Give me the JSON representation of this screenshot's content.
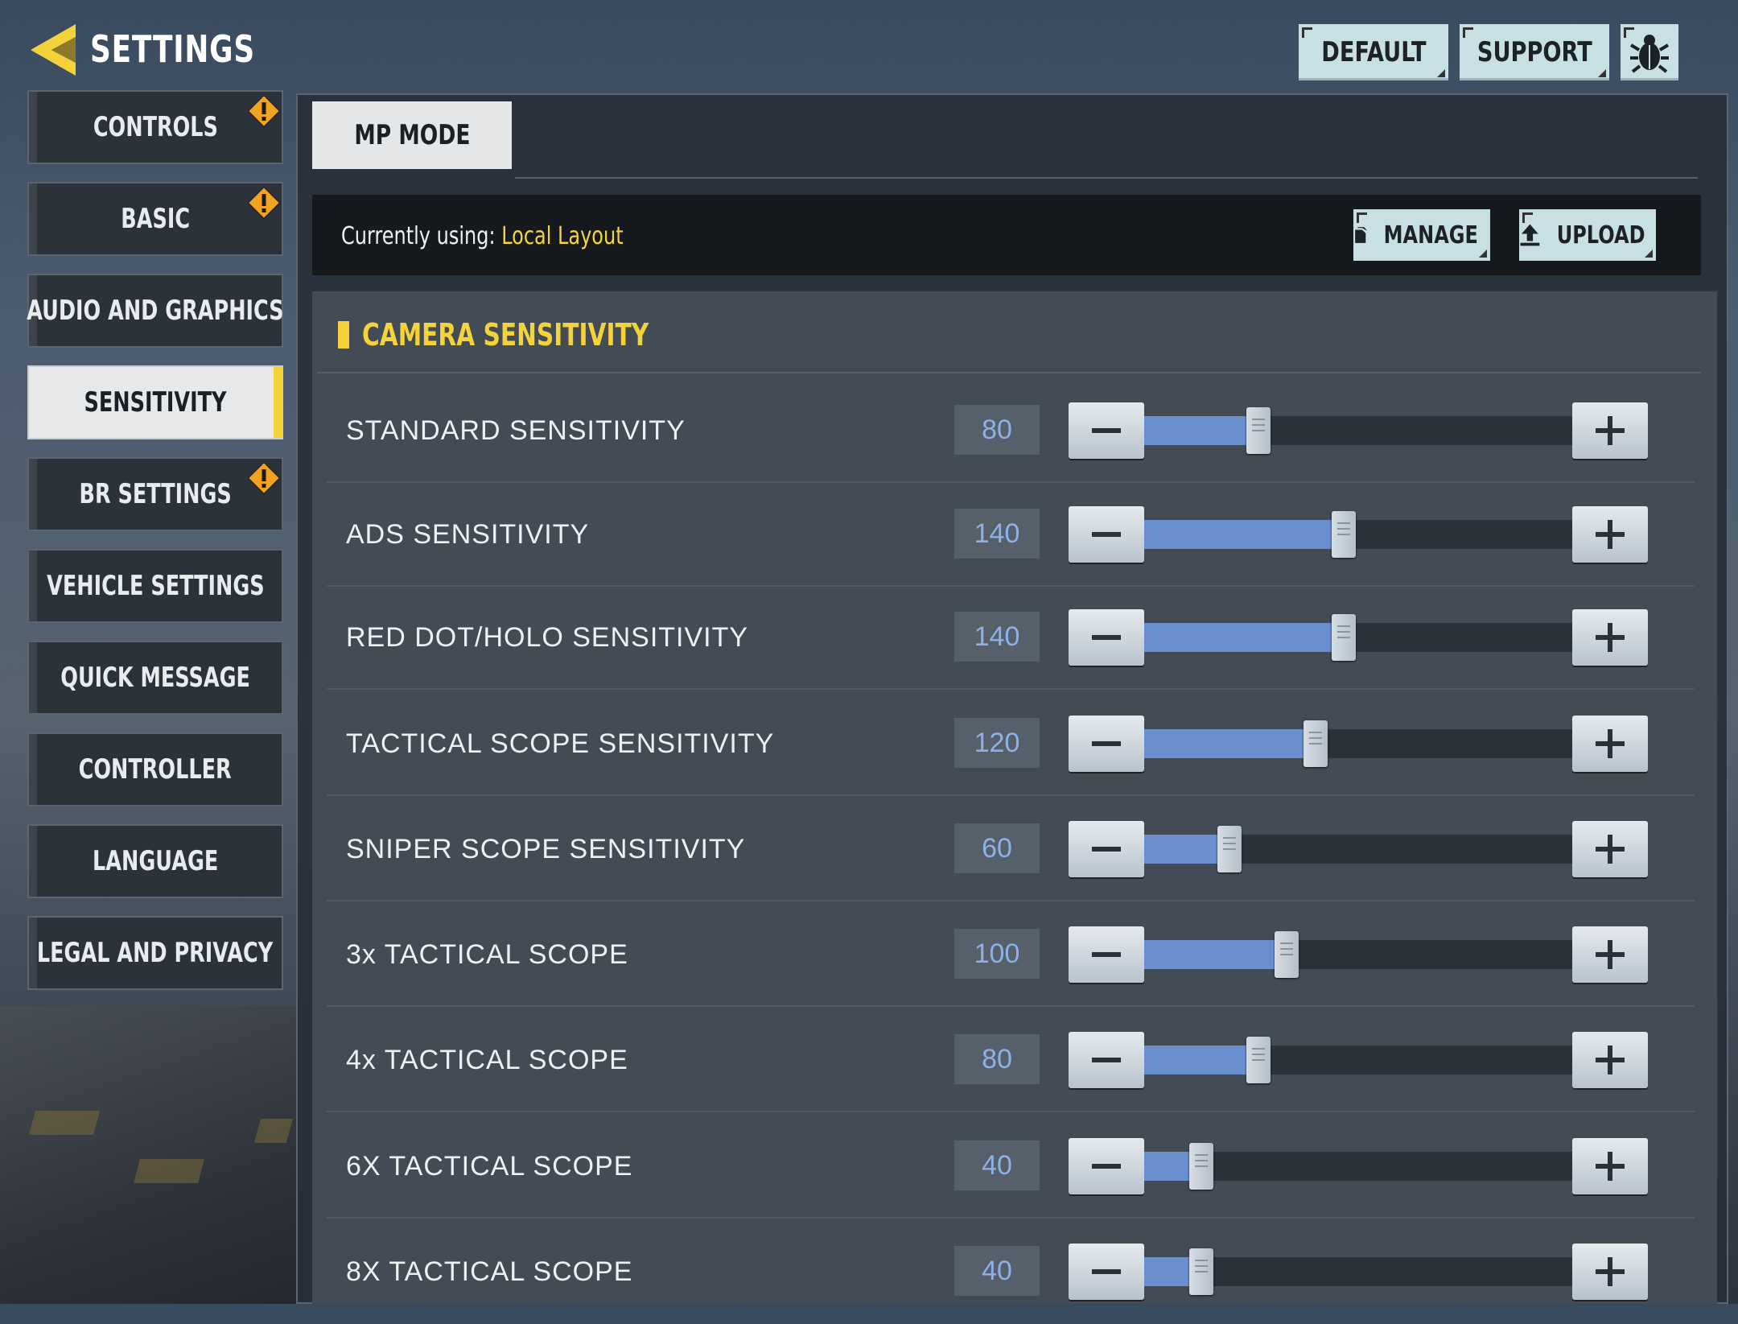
{
  "header": {
    "title": "SETTINGS",
    "buttons": {
      "default": "DEFAULT",
      "support": "SUPPORT"
    },
    "bug_icon": "bug-icon"
  },
  "sidebar": {
    "items": [
      {
        "label": "CONTROLS",
        "warning": true,
        "active": false
      },
      {
        "label": "BASIC",
        "warning": true,
        "active": false
      },
      {
        "label": "AUDIO AND GRAPHICS",
        "warning": false,
        "active": false
      },
      {
        "label": "SENSITIVITY",
        "warning": false,
        "active": true
      },
      {
        "label": "BR SETTINGS",
        "warning": true,
        "active": false
      },
      {
        "label": "VEHICLE SETTINGS",
        "warning": false,
        "active": false
      },
      {
        "label": "QUICK MESSAGE",
        "warning": false,
        "active": false
      },
      {
        "label": "CONTROLLER",
        "warning": false,
        "active": false
      },
      {
        "label": "LANGUAGE",
        "warning": false,
        "active": false
      },
      {
        "label": "LEGAL AND PRIVACY",
        "warning": false,
        "active": false
      }
    ]
  },
  "mode_tab": "MP MODE",
  "layout_bar": {
    "prefix": "Currently using: ",
    "layout_name": "Local Layout",
    "manage": "MANAGE",
    "upload": "UPLOAD"
  },
  "section": {
    "title": "CAMERA SENSITIVITY",
    "slider_max": 300,
    "rows": [
      {
        "label": "STANDARD SENSITIVITY",
        "value": "80"
      },
      {
        "label": "ADS SENSITIVITY",
        "value": "140"
      },
      {
        "label": "RED DOT/HOLO SENSITIVITY",
        "value": "140"
      },
      {
        "label": "TACTICAL SCOPE SENSITIVITY",
        "value": "120"
      },
      {
        "label": "SNIPER SCOPE SENSITIVITY",
        "value": "60"
      },
      {
        "label": "3x TACTICAL SCOPE",
        "value": "100"
      },
      {
        "label": "4x TACTICAL SCOPE",
        "value": "80"
      },
      {
        "label": "6X TACTICAL SCOPE",
        "value": "40"
      },
      {
        "label": "8X TACTICAL SCOPE",
        "value": "40"
      }
    ]
  },
  "colors": {
    "accent_yellow": "#f3d23a",
    "slider_fill": "#6a8fcf",
    "value_text": "#8fb0e6",
    "button_bg": "#c8dfe4"
  }
}
